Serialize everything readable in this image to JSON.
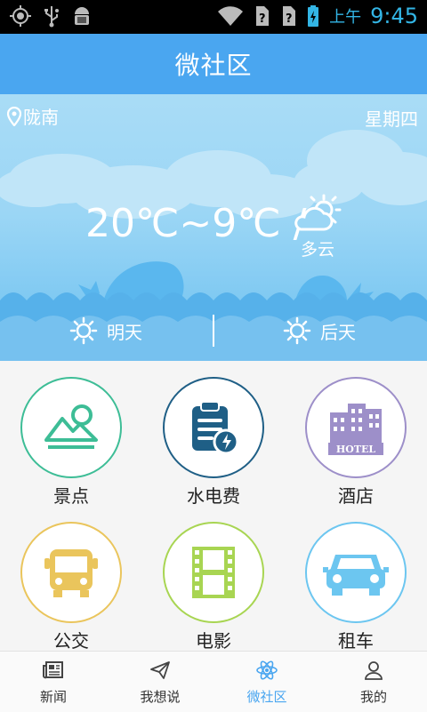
{
  "status_bar": {
    "icons": [
      "gps-icon",
      "usb-icon",
      "android-debug-icon",
      "wifi-icon",
      "sim-unknown-icon",
      "sim-unknown-icon",
      "battery-charging-icon"
    ],
    "ampm": "上午",
    "time": "9:45",
    "accent_color": "#33b5e5"
  },
  "header": {
    "title": "微社区",
    "color": "#4aa6f0"
  },
  "weather": {
    "location": "陇南",
    "weekday": "星期四",
    "temperature": "20℃~9℃ /",
    "condition": "多云",
    "condition_icon": "partly-cloudy-icon",
    "forecast": [
      {
        "label": "明天",
        "icon": "sun-icon"
      },
      {
        "label": "后天",
        "icon": "sun-icon"
      }
    ]
  },
  "services": [
    {
      "label": "景点",
      "icon": "mountain-icon",
      "color": "#3dbd96"
    },
    {
      "label": "水电费",
      "icon": "utility-bill-icon",
      "color": "#1f5f86"
    },
    {
      "label": "酒店",
      "icon": "hotel-icon",
      "color": "#9d8fc9"
    },
    {
      "label": "公交",
      "icon": "bus-icon",
      "color": "#eac55c"
    },
    {
      "label": "电影",
      "icon": "film-icon",
      "color": "#a8d552"
    },
    {
      "label": "租车",
      "icon": "car-icon",
      "color": "#6cc6f0"
    }
  ],
  "bottom_nav": {
    "items": [
      {
        "label": "新闻",
        "icon": "newspaper-icon"
      },
      {
        "label": "我想说",
        "icon": "paper-plane-icon"
      },
      {
        "label": "微社区",
        "icon": "atom-icon",
        "active": true
      },
      {
        "label": "我的",
        "icon": "person-icon"
      }
    ],
    "active_color": "#4aa6f0"
  }
}
